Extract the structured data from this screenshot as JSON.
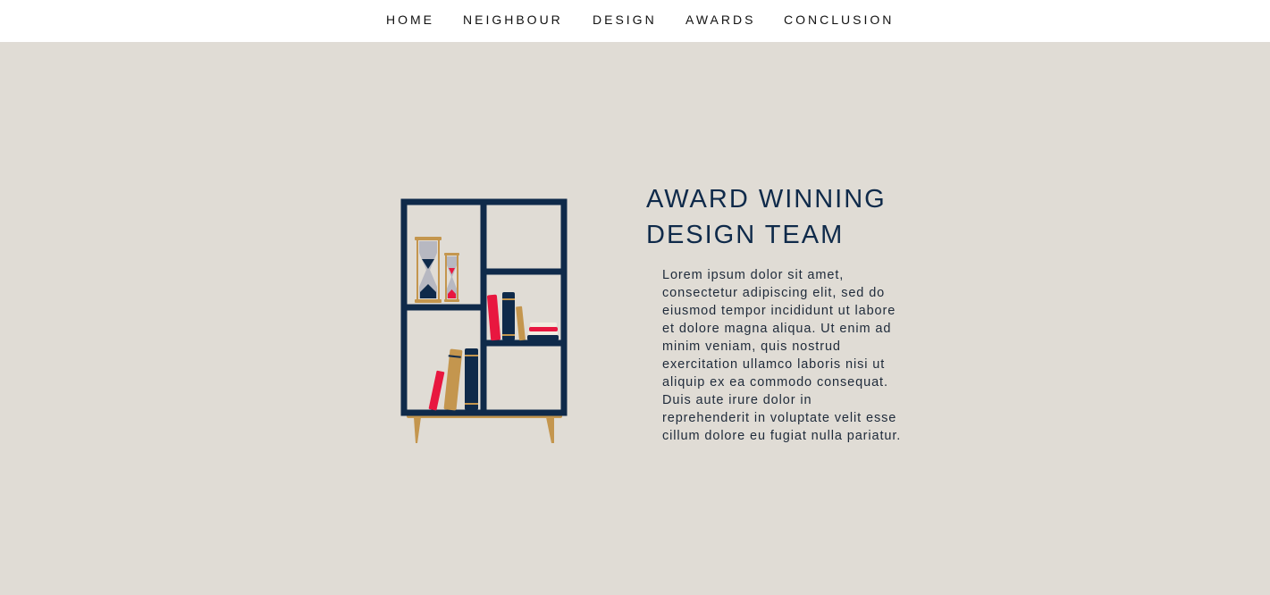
{
  "nav": {
    "items": [
      {
        "label": "HOME"
      },
      {
        "label": "NEIGHBOUR"
      },
      {
        "label": "DESIGN"
      },
      {
        "label": "AWARDS"
      },
      {
        "label": "CONCLUSION"
      }
    ]
  },
  "section": {
    "heading_lines": [
      "AWARD WINNING",
      "DESIGN TEAM"
    ],
    "body_lines": [
      "Lorem ipsum dolor sit amet,",
      "consectetur adipiscing elit, sed do",
      "eiusmod tempor incididunt ut labore",
      "et dolore magna aliqua. Ut enim ad",
      "minim veniam, quis nostrud",
      "exercitation ullamco laboris nisi ut",
      "aliquip ex ea commodo consequat.",
      "Duis aute irure dolor in",
      "reprehenderit in voluptate velit esse",
      "cillum dolore eu fugiat nulla pariatur."
    ]
  },
  "colors": {
    "page_background": "#e0dcd5",
    "nav_background": "#ffffff",
    "navy": "#0f2a4a",
    "gold": "#c4964e",
    "red": "#e8173f",
    "grey": "#b7b8c1"
  },
  "illustration": {
    "icon": "bookshelf-illustration"
  }
}
